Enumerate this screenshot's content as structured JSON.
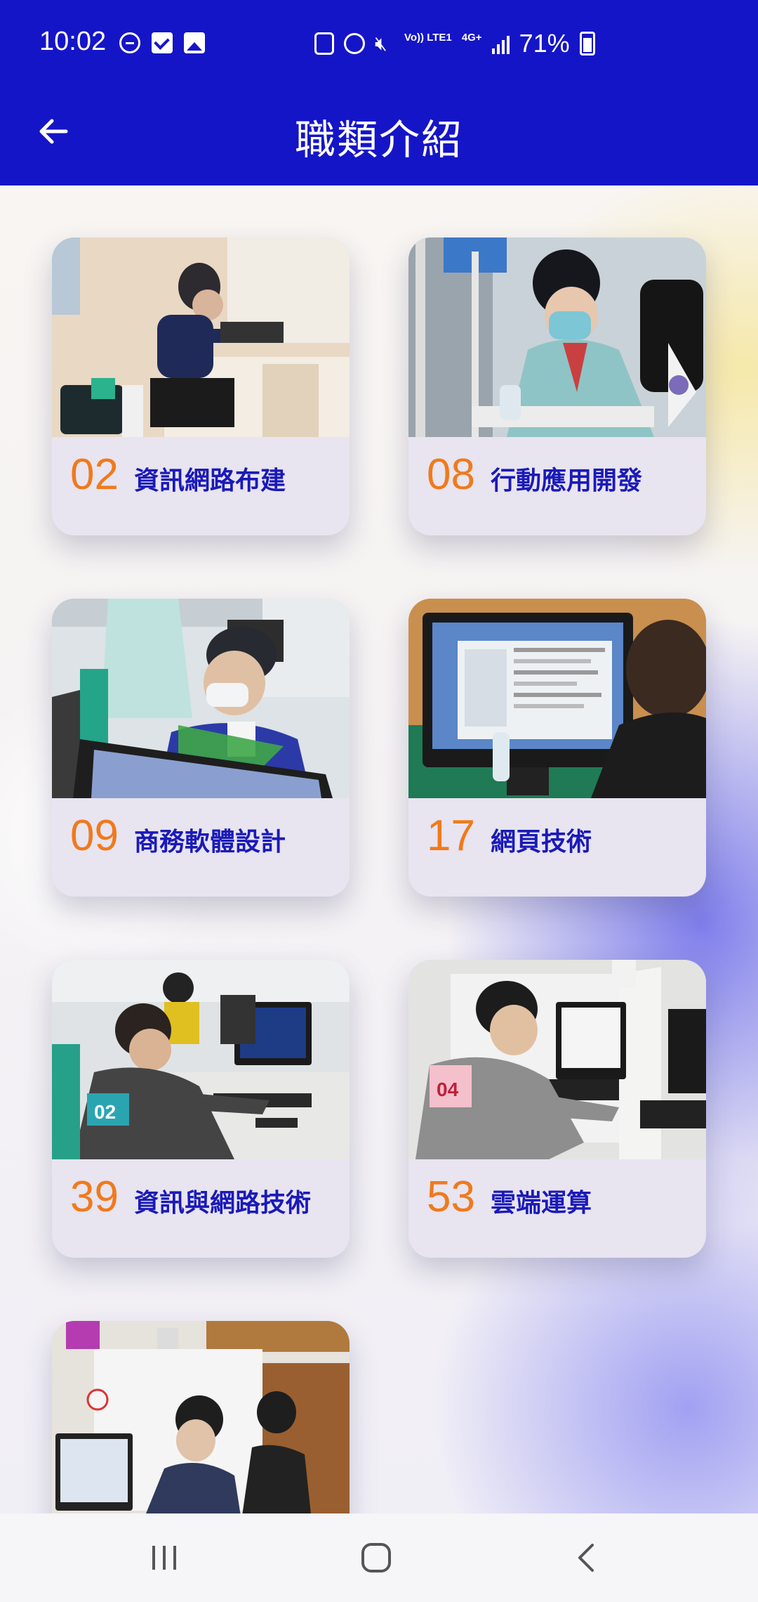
{
  "status_bar": {
    "time": "10:02",
    "network_label": "Vo)) LTE1",
    "network_type": "4G+",
    "battery_percent": "71%"
  },
  "app_bar": {
    "title": "職類介紹",
    "back_icon": "arrow-left-icon"
  },
  "colors": {
    "brand_blue": "#1515c8",
    "number_orange": "#f07a1c",
    "label_blue": "#1a1ab8",
    "card_bg": "#e8e4f0"
  },
  "cards": [
    {
      "number": "02",
      "name": "資訊網路布建"
    },
    {
      "number": "08",
      "name": "行動應用開發"
    },
    {
      "number": "09",
      "name": "商務軟體設計"
    },
    {
      "number": "17",
      "name": "網頁技術"
    },
    {
      "number": "39",
      "name": "資訊與網路技術"
    },
    {
      "number": "53",
      "name": "雲端運算"
    },
    {
      "number": "",
      "name": ""
    }
  ],
  "nav_bar": {
    "recents_icon": "recents-icon",
    "home_icon": "home-icon",
    "back_icon": "back-chevron-icon"
  }
}
